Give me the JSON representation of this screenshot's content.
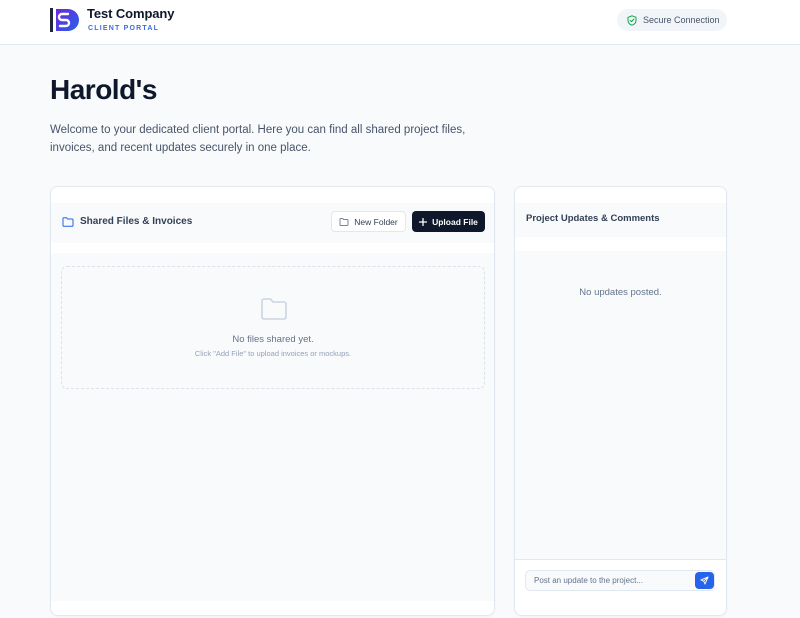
{
  "header": {
    "company_name": "Test Company",
    "portal_label": "CLIENT PORTAL",
    "secure_label": "Secure Connection",
    "logo_icon": "s-monogram-logo",
    "secure_icon": "shield-check-icon"
  },
  "main": {
    "title": "Harold's",
    "description": "Welcome to your dedicated client portal. Here you can find all shared project files, invoices, and recent updates securely in one place."
  },
  "files": {
    "title": "Shared Files & Invoices",
    "title_icon": "folder-icon",
    "new_folder_label": "New Folder",
    "upload_label": "Upload File",
    "empty_title": "No files shared yet.",
    "empty_hint": "Click \"Add File\" to upload invoices or mockups."
  },
  "updates": {
    "title": "Project Updates & Comments",
    "empty_text": "No updates posted.",
    "input_placeholder": "Post an update to the project...",
    "send_icon": "send-icon"
  },
  "colors": {
    "accent": "#2563eb",
    "dark_button": "#0f172a",
    "brand_blue": "#3b6fd8",
    "brand_purple": "#6d28d9",
    "secure_green": "#16a34a",
    "background": "#f8fafc"
  }
}
